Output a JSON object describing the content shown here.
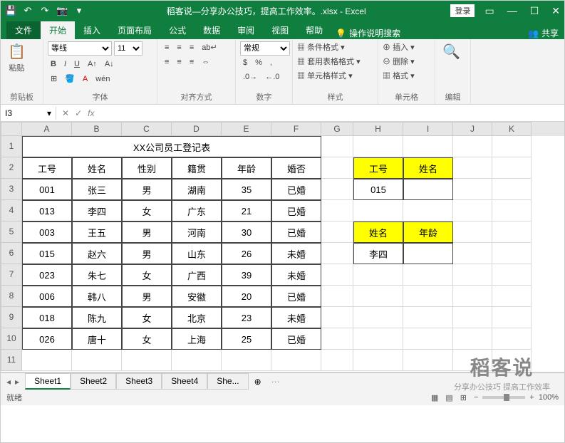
{
  "title": "稻客说—分享办公技巧，提高工作效率。.xlsx - Excel",
  "login": "登录",
  "tabs": {
    "file": "文件",
    "home": "开始",
    "insert": "插入",
    "layout": "页面布局",
    "formula": "公式",
    "data": "数据",
    "review": "审阅",
    "view": "视图",
    "help": "帮助",
    "tellme": "操作说明搜索",
    "share": "共享"
  },
  "groups": {
    "clipboard": "剪贴板",
    "font": "字体",
    "align": "对齐方式",
    "number": "数字",
    "styles": "样式",
    "cells": "单元格",
    "editing": "编辑"
  },
  "ribbon": {
    "paste": "粘贴",
    "font_name": "等线",
    "font_size": "11",
    "number_format": "常规",
    "cond_fmt": "条件格式",
    "table_fmt": "套用表格格式",
    "cell_style": "单元格样式",
    "insert": "插入",
    "delete": "删除",
    "format": "格式"
  },
  "namebox": "I3",
  "cols": [
    "A",
    "B",
    "C",
    "D",
    "E",
    "F",
    "G",
    "H",
    "I",
    "J",
    "K"
  ],
  "widths": [
    70,
    70,
    70,
    70,
    70,
    70,
    45,
    70,
    70,
    55,
    55
  ],
  "row_labels": [
    "1",
    "2",
    "3",
    "4",
    "5",
    "6",
    "7",
    "8",
    "9",
    "10",
    "11"
  ],
  "merged_title": "XX公司员工登记表",
  "headers": [
    "工号",
    "姓名",
    "性别",
    "籍贯",
    "年龄",
    "婚否"
  ],
  "records": [
    [
      "001",
      "张三",
      "男",
      "湖南",
      "35",
      "已婚"
    ],
    [
      "013",
      "李四",
      "女",
      "广东",
      "21",
      "已婚"
    ],
    [
      "003",
      "王五",
      "男",
      "河南",
      "30",
      "已婚"
    ],
    [
      "015",
      "赵六",
      "男",
      "山东",
      "26",
      "未婚"
    ],
    [
      "023",
      "朱七",
      "女",
      "广西",
      "39",
      "未婚"
    ],
    [
      "006",
      "韩八",
      "男",
      "安徽",
      "20",
      "已婚"
    ],
    [
      "018",
      "陈九",
      "女",
      "北京",
      "23",
      "未婚"
    ],
    [
      "026",
      "唐十",
      "女",
      "上海",
      "25",
      "已婚"
    ]
  ],
  "lookup1": {
    "h": "工号",
    "i": "姓名",
    "value": "015"
  },
  "lookup2": {
    "h": "姓名",
    "i": "年龄",
    "value": "李四"
  },
  "sheets": [
    "Sheet1",
    "Sheet2",
    "Sheet3",
    "Sheet4",
    "She..."
  ],
  "status": "就绪",
  "zoom": "100%",
  "watermark": {
    "big": "稻客说",
    "small": "分享办公技巧 提高工作效率"
  }
}
